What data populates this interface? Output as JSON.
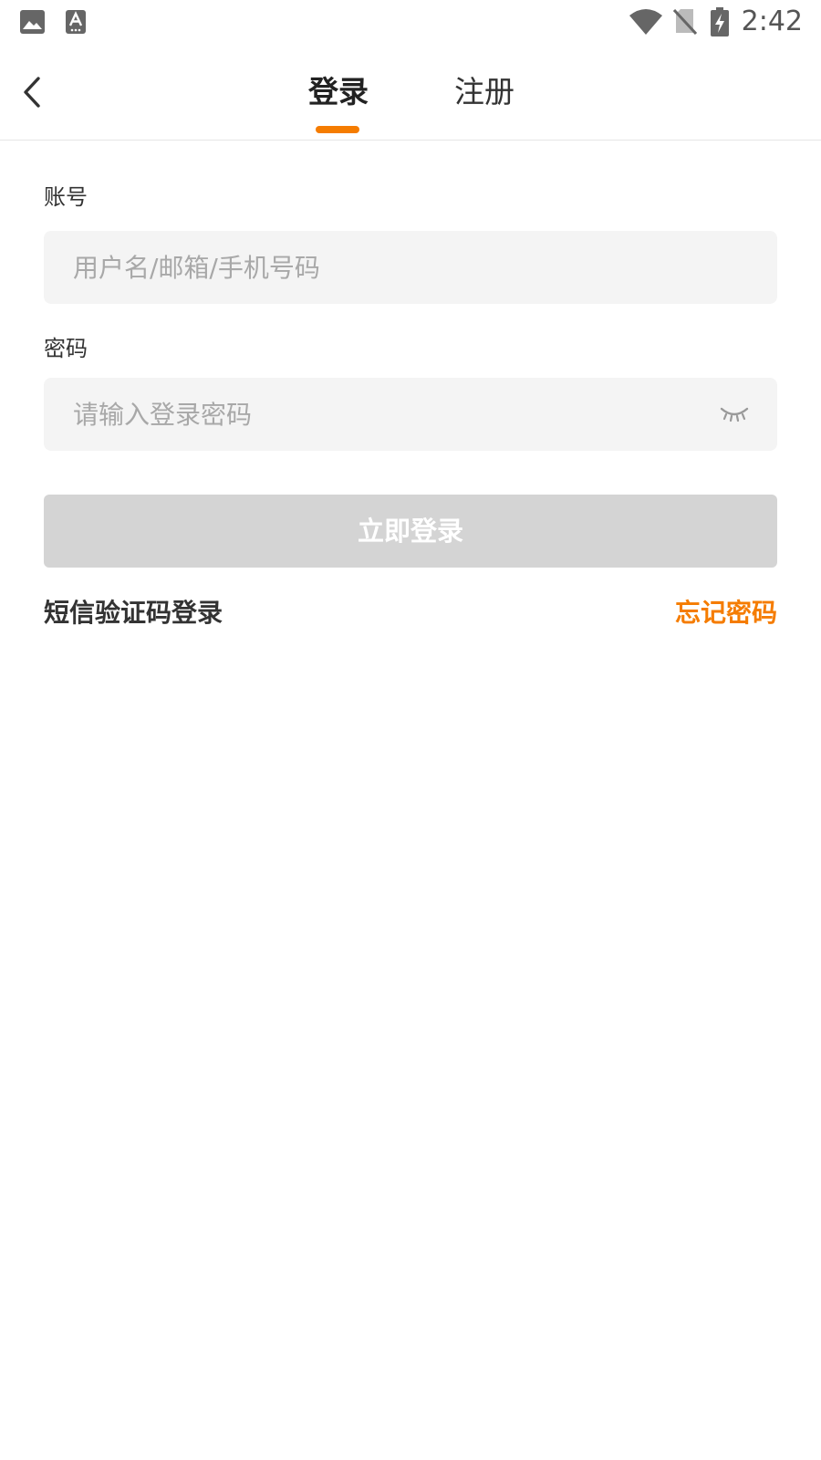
{
  "status_bar": {
    "time": "2:42",
    "icons": [
      "image-icon",
      "text-input-icon",
      "wifi-icon",
      "no-sim-icon",
      "battery-charging-icon"
    ]
  },
  "header": {
    "tabs": [
      {
        "label": "登录",
        "active": true
      },
      {
        "label": "注册",
        "active": false
      }
    ],
    "accent_color": "#f57c00"
  },
  "form": {
    "account_label": "账号",
    "account_placeholder": "用户名/邮箱/手机号码",
    "account_value": "",
    "password_label": "密码",
    "password_placeholder": "请输入登录密码",
    "password_value": "",
    "password_visibility_icon": "eye-closed-icon",
    "submit_label": "立即登录",
    "submit_color": "#d4d4d4"
  },
  "links": {
    "sms_login": "短信验证码登录",
    "forgot_password": "忘记密码"
  }
}
